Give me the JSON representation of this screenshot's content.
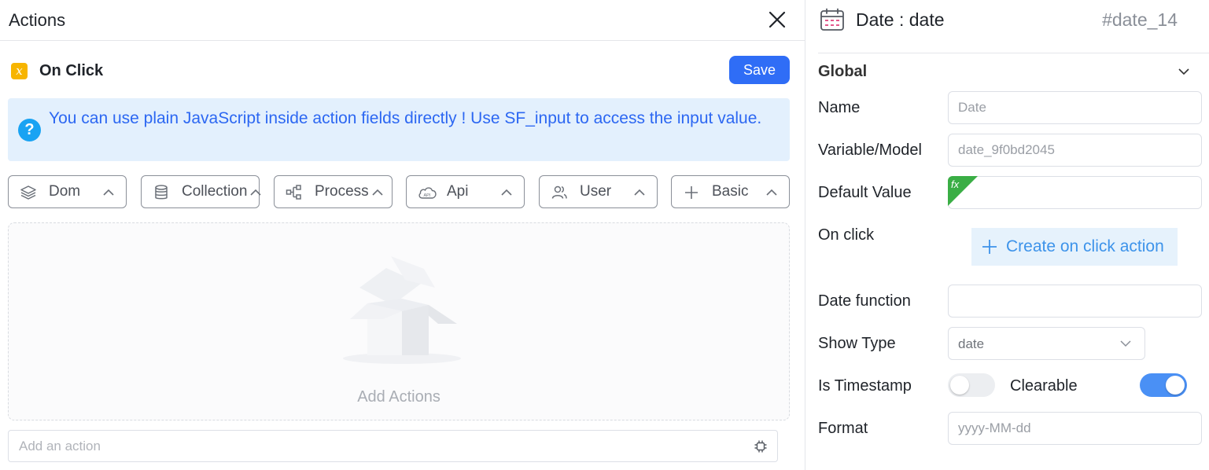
{
  "actions_panel": {
    "title": "Actions",
    "event": {
      "icon": "variable-x-icon",
      "label": "On Click"
    },
    "save_label": "Save",
    "tip": "You can use plain JavaScript inside action fields directly ! Use SF_input to access the input value.",
    "tabs": [
      {
        "label": "Dom",
        "icon": "layers-icon"
      },
      {
        "label": "Collection",
        "icon": "database-icon"
      },
      {
        "label": "Process",
        "icon": "flow-icon"
      },
      {
        "label": "Api",
        "icon": "cloud-api-icon"
      },
      {
        "label": "User",
        "icon": "users-icon"
      },
      {
        "label": "Basic",
        "icon": "plus-icon"
      }
    ],
    "empty_label": "Add Actions",
    "add_action_placeholder": "Add an action"
  },
  "properties_panel": {
    "component_title": "Date : date",
    "component_id": "#date_14",
    "section": "Global",
    "fields": {
      "name": {
        "label": "Name",
        "placeholder": "Date"
      },
      "variable": {
        "label": "Variable/Model",
        "placeholder": "date_9f0bd2045"
      },
      "default_value": {
        "label": "Default Value",
        "fx": "fx"
      },
      "on_click": {
        "label": "On click",
        "button": "Create on click action"
      },
      "date_function": {
        "label": "Date function"
      },
      "show_type": {
        "label": "Show Type",
        "value": "date"
      },
      "is_timestamp": {
        "label": "Is Timestamp",
        "on": false
      },
      "clearable": {
        "label": "Clearable",
        "on": true
      },
      "format": {
        "label": "Format",
        "placeholder": "yyyy-MM-dd"
      }
    }
  },
  "colors": {
    "primary": "#2f6df6",
    "tip_bg": "#e3f0fd",
    "tip_text": "#2c67f2",
    "badge": "#f7b500",
    "fx_green": "#3aae45",
    "toggle_on": "#4a90f5"
  }
}
